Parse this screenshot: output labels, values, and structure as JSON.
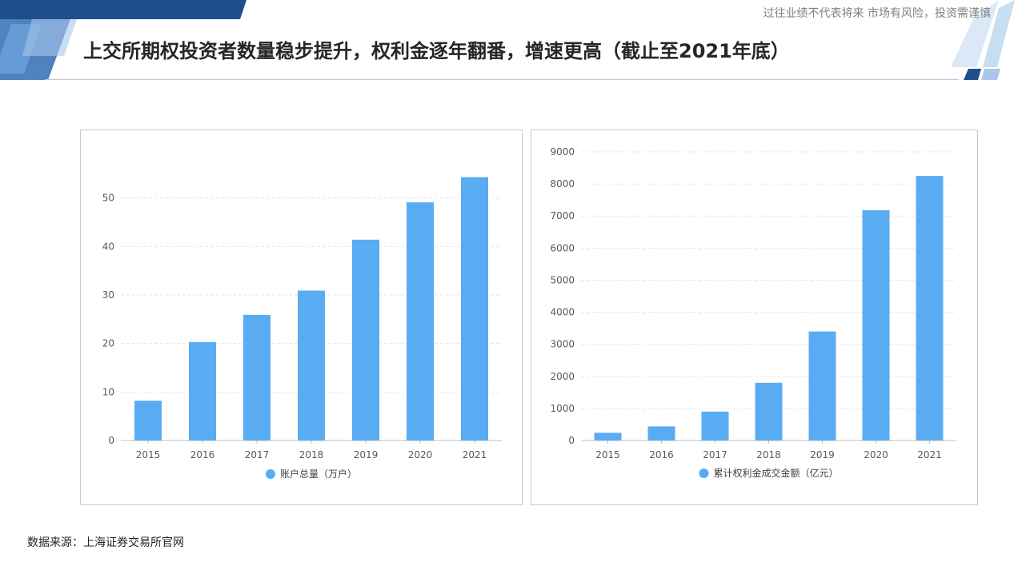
{
  "header": {
    "disclaimer": "过往业绩不代表将来  市场有风险，投资需谨慎",
    "title": "上交所期权投资者数量稳步提升，权利金逐年翻番，增速更高（截止至2021年底）"
  },
  "footer": {
    "source": "数据来源：上海证券交易所官网"
  },
  "colors": {
    "bar": "#5aacf2",
    "grid": "#e6e6e6",
    "axis": "#bfbfbf",
    "brand_dark": "#1f4e8c",
    "brand_light": "#a9c7ea"
  },
  "chart_data": [
    {
      "type": "bar",
      "categories": [
        "2015",
        "2016",
        "2017",
        "2018",
        "2019",
        "2020",
        "2021"
      ],
      "series": [
        {
          "name": "账户总量（万户）",
          "values": [
            8.2,
            20.3,
            25.9,
            30.9,
            41.4,
            49.1,
            54.3
          ]
        }
      ],
      "yticks": [
        "0",
        "10",
        "20",
        "30",
        "40",
        "50"
      ],
      "ylim": [
        0,
        60
      ],
      "grid": true,
      "legend": "bottom-center"
    },
    {
      "type": "bar",
      "categories": [
        "2015",
        "2016",
        "2017",
        "2018",
        "2019",
        "2020",
        "2021"
      ],
      "series": [
        {
          "name": "累计权利金成交金额（亿元）",
          "values": [
            240,
            440,
            900,
            1800,
            3400,
            7180,
            8250
          ]
        }
      ],
      "yticks": [
        "0",
        "1000",
        "2000",
        "3000",
        "4000",
        "5000",
        "6000",
        "7000",
        "8000",
        "9000"
      ],
      "ylim": [
        0,
        9000
      ],
      "grid": true,
      "legend": "bottom-center"
    }
  ]
}
